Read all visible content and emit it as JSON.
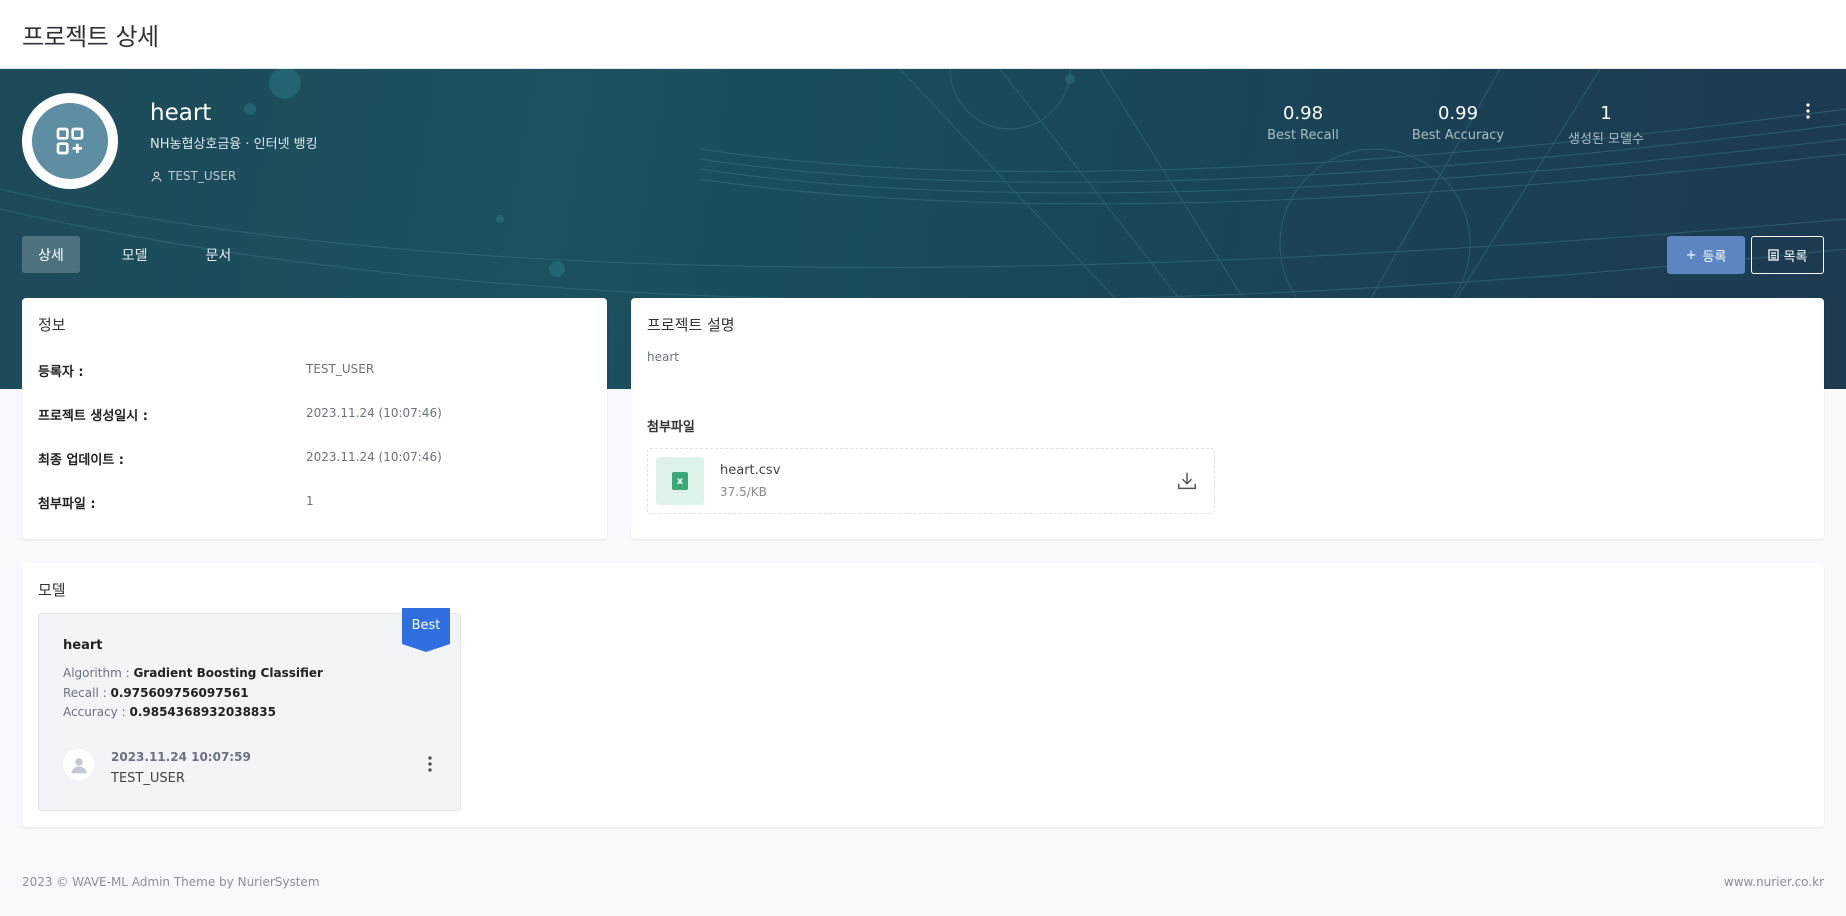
{
  "page": {
    "title": "프로젝트 상세"
  },
  "project": {
    "name": "heart",
    "subtitle": "NH농협상호금융 · 인터넷 뱅킹",
    "user": "TEST_USER"
  },
  "stats": [
    {
      "value": "0.98",
      "label": "Best Recall"
    },
    {
      "value": "0.99",
      "label": "Best Accuracy"
    },
    {
      "value": "1",
      "label": "생성된 모델수"
    }
  ],
  "tabs": [
    {
      "label": "상세",
      "active": true
    },
    {
      "label": "모델",
      "active": false
    },
    {
      "label": "문서",
      "active": false
    }
  ],
  "actions": {
    "add_label": "등록",
    "list_label": "목록"
  },
  "info": {
    "title": "정보",
    "rows": [
      {
        "label": "등록자 :",
        "value": "TEST_USER"
      },
      {
        "label": "프로젝트 생성일시 :",
        "value": "2023.11.24 (10:07:46)"
      },
      {
        "label": "최종 업데이트 :",
        "value": "2023.11.24 (10:07:46)"
      },
      {
        "label": "첨부파일 :",
        "value": "1"
      }
    ]
  },
  "description": {
    "title": "프로젝트 설명",
    "text": "heart",
    "attach_label": "첨부파일",
    "file": {
      "name": "heart.csv",
      "size": "37.5/KB",
      "icon": "excel-file-icon"
    }
  },
  "models": {
    "title": "모델",
    "items": [
      {
        "badge": "Best",
        "name": "heart",
        "algorithm_label": "Algorithm : ",
        "algorithm": "Gradient Boosting Classifier",
        "recall_label": "Recall : ",
        "recall": "0.975609756097561",
        "accuracy_label": "Accuracy : ",
        "accuracy": "0.9854368932038835",
        "date": "2023.11.24 10:07:59",
        "user": "TEST_USER"
      }
    ]
  },
  "footer": {
    "left": "2023 © WAVE-ML Admin Theme by NurierSystem",
    "right": "www.nurier.co.kr"
  },
  "colors": {
    "accent": "#5b86c2",
    "badge": "#2f6fe0",
    "hero": "#1c5160"
  }
}
